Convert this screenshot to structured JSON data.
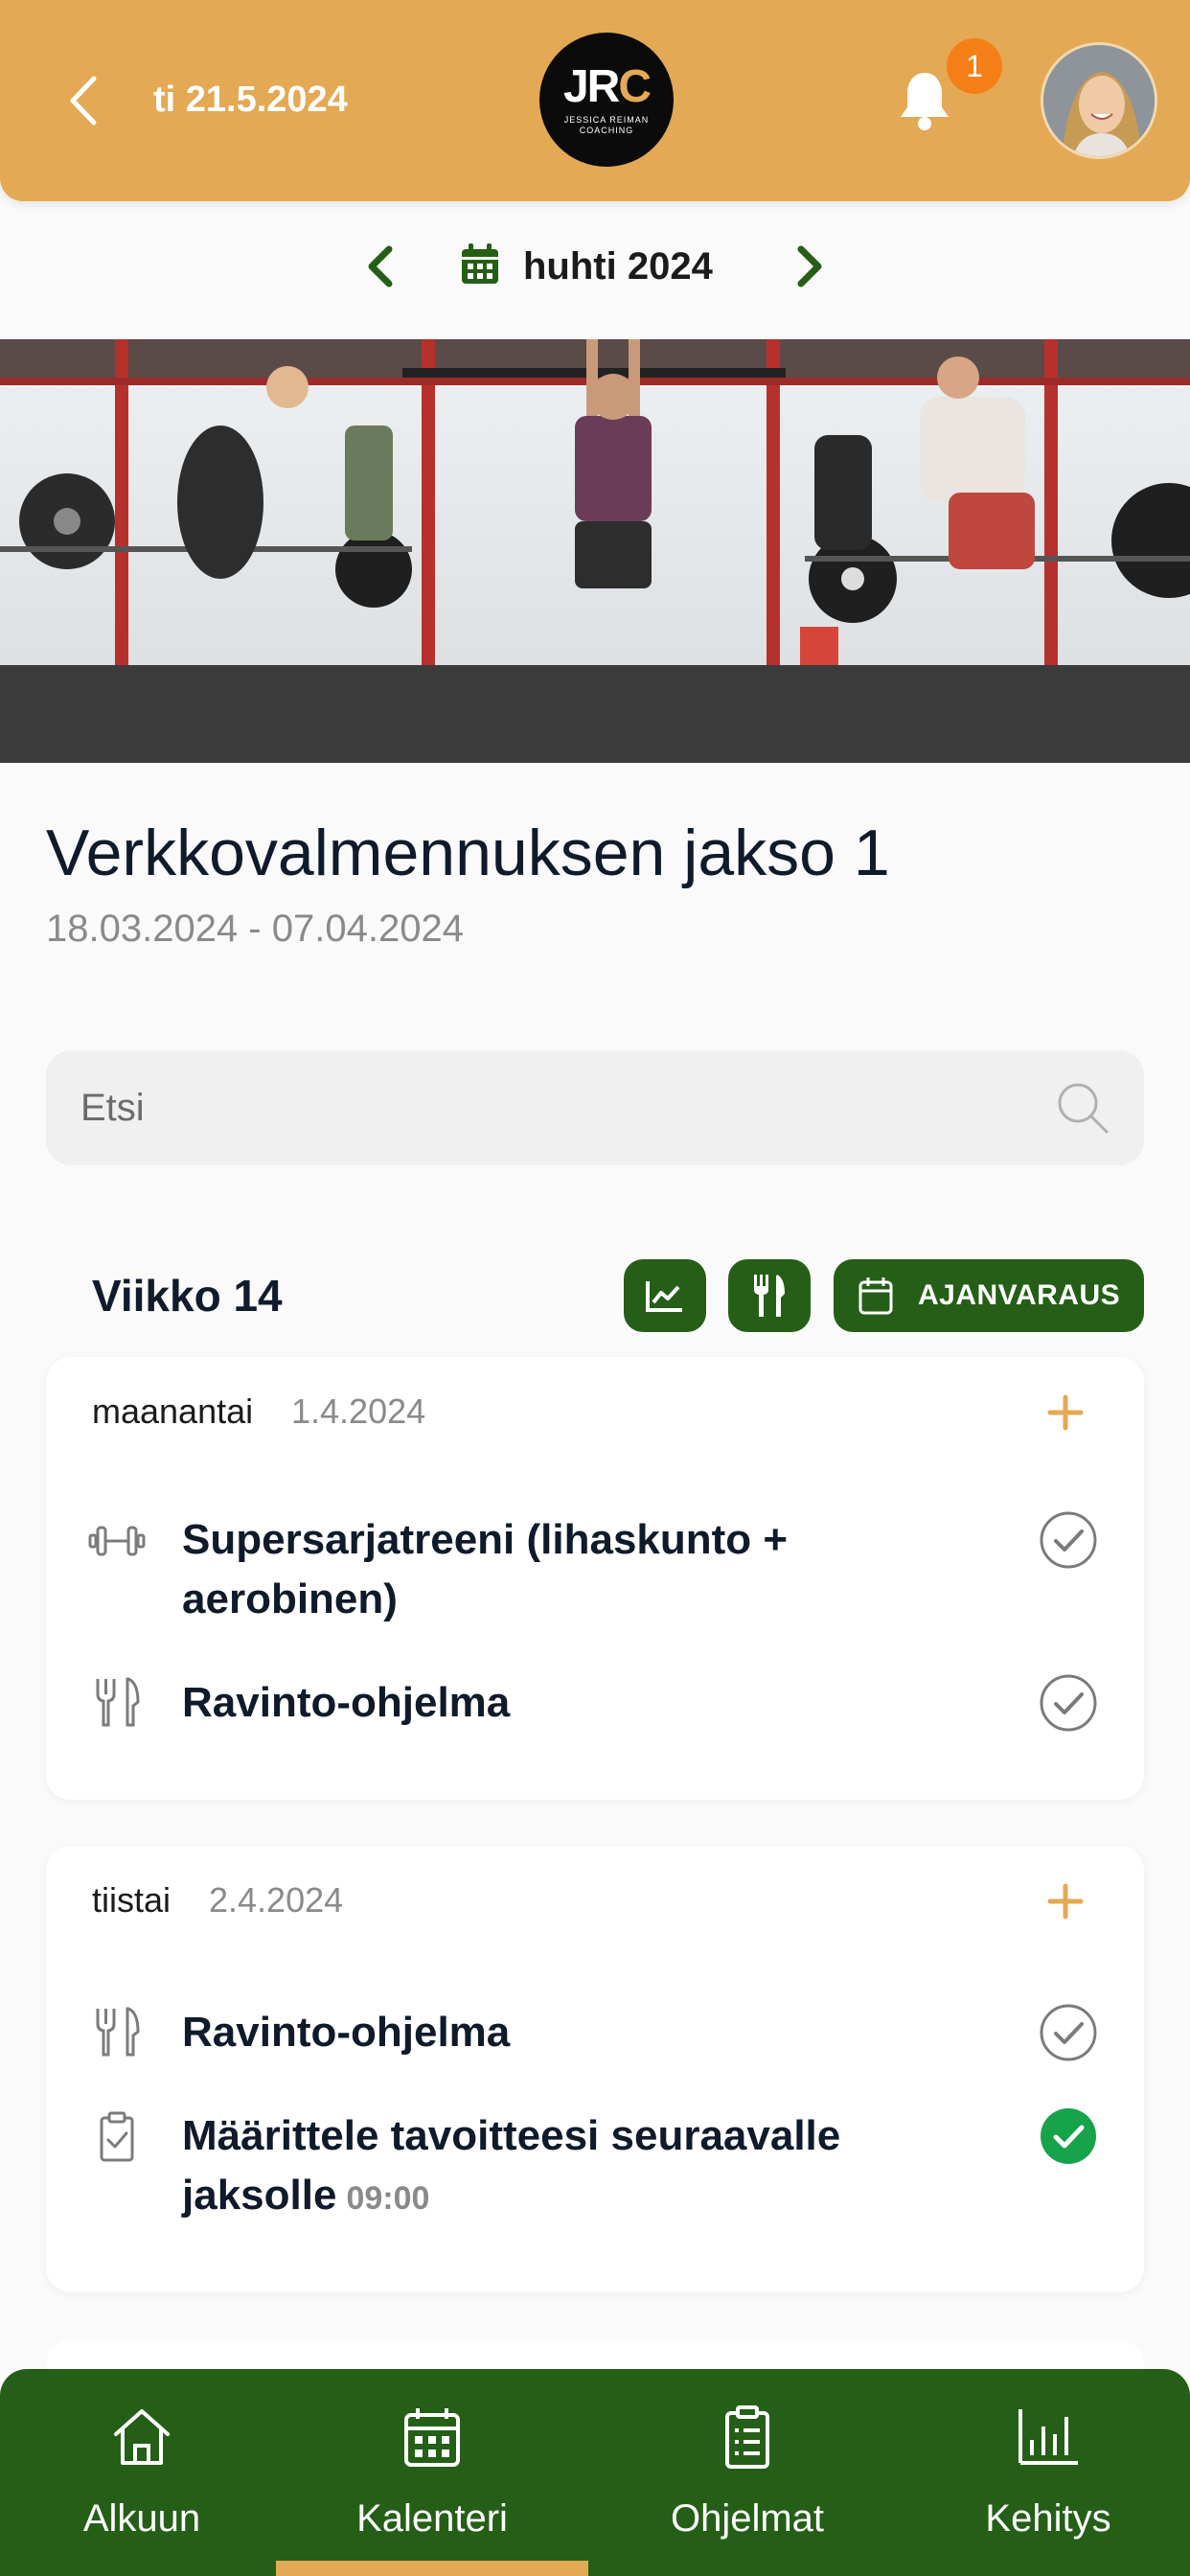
{
  "header": {
    "date": "ti 21.5.2024",
    "logo_mark": "JRC",
    "logo_sub": "JESSICA REIMAN COACHING",
    "notification_count": "1",
    "accent_color": "#e3a955"
  },
  "month_nav": {
    "label": "huhti 2024"
  },
  "program": {
    "title": "Verkkovalmennuksen jakso 1",
    "dates": "18.03.2024 - 07.04.2024"
  },
  "search": {
    "placeholder": "Etsi"
  },
  "week": {
    "label": "Viikko 14",
    "booking_label": "AJANVARAUS"
  },
  "days": [
    {
      "weekday": "maanantai",
      "date": "1.4.2024",
      "entries": [
        {
          "icon": "dumbbell-icon",
          "title": "Supersarjatreeni (lihaskunto + aerobinen)",
          "done": false
        },
        {
          "icon": "fork-knife-icon",
          "title": "Ravinto-ohjelma",
          "done": false
        }
      ]
    },
    {
      "weekday": "tiistai",
      "date": "2.4.2024",
      "entries": [
        {
          "icon": "fork-knife-icon",
          "title": "Ravinto-ohjelma",
          "done": false
        },
        {
          "icon": "clipboard-check-icon",
          "title": "Määrittele tavoitteesi seuraavalle jaksolle",
          "time": "09:00",
          "done": true
        }
      ]
    }
  ],
  "bottom_nav": {
    "items": [
      {
        "label": "Alkuun",
        "icon": "home-icon"
      },
      {
        "label": "Kalenteri",
        "icon": "calendar-icon",
        "active": true
      },
      {
        "label": "Ohjelmat",
        "icon": "clipboard-list-icon"
      },
      {
        "label": "Kehitys",
        "icon": "bar-chart-icon"
      }
    ],
    "color": "#255f17"
  }
}
